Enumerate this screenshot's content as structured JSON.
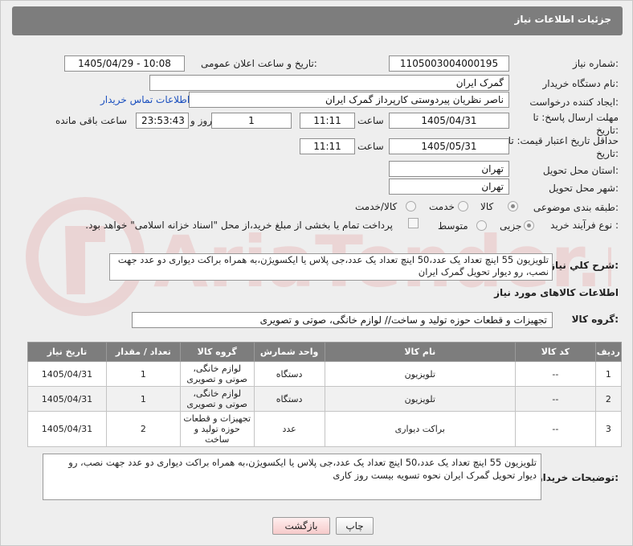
{
  "header": {
    "title": "جزئیات اطلاعات نیاز"
  },
  "form": {
    "need_number_label": "شماره نیاز:",
    "need_number": "1105003004000195",
    "announce_label": "تاریخ و ساعت اعلان عمومی:",
    "announce_value": "1405/04/29 - 10:08",
    "buyer_org_label": "نام دستگاه خریدار:",
    "buyer_org": "گمرک ایران",
    "creator_label": "ایجاد کننده درخواست:",
    "creator": "ناصر نظریان پیردوستی کارپرداز گمرک ایران",
    "contact_link": "اطلاعات تماس خریدار",
    "reply_deadline_label": "مهلت ارسال پاسخ: تا تاریخ:",
    "reply_date": "1405/04/31",
    "time_label": "ساعت",
    "reply_time": "11:11",
    "days": "1",
    "days_label": "روز و",
    "remaining": "23:53:43",
    "remaining_label": "ساعت باقی مانده",
    "min_validity_label": "حداقل تاریخ اعتبار قیمت: تا تاریخ:",
    "validity_date": "1405/05/31",
    "validity_time": "11:11",
    "province_label": "استان محل تحویل:",
    "province": "تهران",
    "city_label": "شهر محل تحویل:",
    "city": "تهران",
    "category_label": "طبقه بندی موضوعی:",
    "category_options": [
      "کالا",
      "خدمت",
      "کالا/خدمت"
    ],
    "category_selected": "کالا",
    "process_label": "نوع فرآیند خرید :",
    "process_options": [
      "جزیی",
      "متوسط"
    ],
    "process_selected": "جزیی",
    "payment_note": "پرداخت تمام یا بخشی از مبلغ خرید،از محل \"اسناد خزانه اسلامی\" خواهد بود."
  },
  "description": {
    "label": "شرح کلي نياز:",
    "text": "تلویزیون 55 اینچ تعداد یک عدد،50 اینچ تعداد یک عدد،جی پلاس یا ایکسویژن،به همراه براکت دیواری دو عدد جهت نصب، رو دیوار تحویل گمرک ایران"
  },
  "goods": {
    "section_title": "اطلاعات کالاهای مورد نیاز",
    "group_label": "گروه کالا:",
    "group_value": "تجهیزات و قطعات حوزه تولید و ساخت// لوازم خانگی، صوتی و تصویری",
    "columns": [
      "ردیف",
      "کد کالا",
      "نام کالا",
      "واحد شمارش",
      "گروه کالا",
      "تعداد / مقدار",
      "تاریخ نیاز"
    ],
    "rows": [
      {
        "row": "1",
        "code": "--",
        "name": "تلویزیون",
        "unit": "دستگاه",
        "group": "لوازم خانگی، صوتی و تصویری",
        "qty": "1",
        "date": "1405/04/31"
      },
      {
        "row": "2",
        "code": "--",
        "name": "تلویزیون",
        "unit": "دستگاه",
        "group": "لوازم خانگی، صوتی و تصویری",
        "qty": "1",
        "date": "1405/04/31"
      },
      {
        "row": "3",
        "code": "--",
        "name": "براکت دیواری",
        "unit": "عدد",
        "group": "تجهیزات و قطعات حوزه تولید و ساخت",
        "qty": "2",
        "date": "1405/04/31"
      }
    ]
  },
  "buyer_notes": {
    "label": "توضیحات خریدار:",
    "text": "تلویزیون 55 اینچ تعداد یک عدد،50 اینچ تعداد یک عدد،جی پلاس یا ایکسویژن،به همراه براکت دیواری دو عدد جهت نصب، رو دیوار تحویل گمرک ایران نحوه تسویه بیست روز کاری"
  },
  "buttons": {
    "print": "چاپ",
    "back": "بازگشت"
  },
  "watermark_text": "AriaTender.net",
  "colors": {
    "header": "#7d7d7d",
    "link": "#1a4fbf",
    "watermark": "#e6b5b5"
  }
}
